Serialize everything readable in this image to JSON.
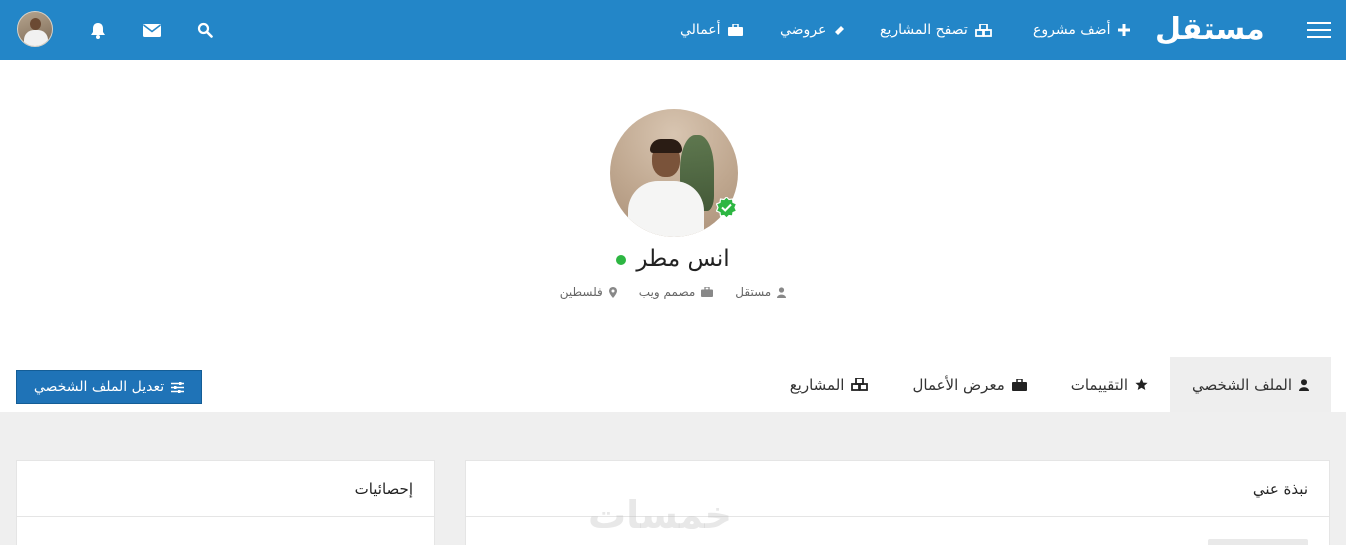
{
  "header": {
    "logo": "مستقل",
    "nav": [
      {
        "label": "أضف مشروع",
        "icon": "plus-icon"
      },
      {
        "label": "تصفح المشاريع",
        "icon": "cubes-icon"
      },
      {
        "label": "عروضي",
        "icon": "ticket-icon"
      },
      {
        "label": "أعمالي",
        "icon": "briefcase-icon"
      }
    ],
    "icons": [
      "hamburger-icon",
      "search-icon",
      "envelope-icon",
      "bell-icon"
    ],
    "colors": {
      "bar": "#2386c8"
    }
  },
  "profile": {
    "name": "انس مطر",
    "online": true,
    "meta": {
      "role_type": "مستقل",
      "job": "مصمم ويب",
      "country": "فلسطين"
    },
    "colors": {
      "online": "#2db642",
      "verified": "#2db642"
    }
  },
  "tabs": [
    {
      "label": "الملف الشخصي",
      "icon": "user-icon",
      "active": true
    },
    {
      "label": "التقييمات",
      "icon": "star-icon",
      "active": false
    },
    {
      "label": "معرض الأعمال",
      "icon": "briefcase-icon",
      "active": false
    },
    {
      "label": "المشاريع",
      "icon": "cubes-icon",
      "active": false
    }
  ],
  "edit_button": {
    "label": "تعديل الملف الشخصي",
    "icon": "sliders-icon"
  },
  "cards": {
    "about_title": "نبذة عني",
    "stats_title": "إحصائيات"
  },
  "watermark": "خمسات"
}
